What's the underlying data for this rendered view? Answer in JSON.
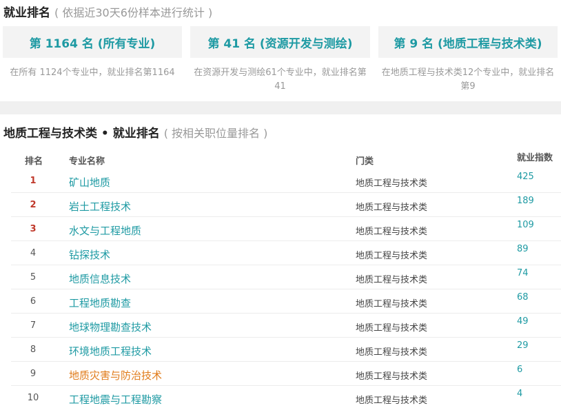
{
  "employment_ranking": {
    "title": "就业排名",
    "subtitle": "( 依据近30天6份样本进行统计 )",
    "cards": [
      {
        "label": "第 1164 名 (所有专业)",
        "desc": "在所有 1124个专业中，就业排名第1164"
      },
      {
        "label": "第 41 名 (资源开发与测绘)",
        "desc": "在资源开发与测绘61个专业中，就业排名第41"
      },
      {
        "label": "第 9 名 (地质工程与技术类)",
        "desc": "在地质工程与技术类12个专业中，就业排名第9"
      }
    ]
  },
  "category_ranking": {
    "title": "地质工程与技术类 • 就业排名",
    "subtitle": "( 按相关职位量排名 )",
    "headers": {
      "rank": "排名",
      "name": "专业名称",
      "category": "门类",
      "index": "就业指数"
    },
    "rows": [
      {
        "rank": "1",
        "name": "矿山地质",
        "category": "地质工程与技术类",
        "index": "425"
      },
      {
        "rank": "2",
        "name": "岩土工程技术",
        "category": "地质工程与技术类",
        "index": "189"
      },
      {
        "rank": "3",
        "name": "水文与工程地质",
        "category": "地质工程与技术类",
        "index": "109"
      },
      {
        "rank": "4",
        "name": "钻探技术",
        "category": "地质工程与技术类",
        "index": "89"
      },
      {
        "rank": "5",
        "name": "地质信息技术",
        "category": "地质工程与技术类",
        "index": "74"
      },
      {
        "rank": "6",
        "name": "工程地质勘查",
        "category": "地质工程与技术类",
        "index": "68"
      },
      {
        "rank": "7",
        "name": "地球物理勘查技术",
        "category": "地质工程与技术类",
        "index": "49"
      },
      {
        "rank": "8",
        "name": "环境地质工程技术",
        "category": "地质工程与技术类",
        "index": "29"
      },
      {
        "rank": "9",
        "name": "地质灾害与防治技术",
        "category": "地质工程与技术类",
        "index": "6"
      },
      {
        "rank": "10",
        "name": "工程地震与工程勘察",
        "category": "地质工程与技术类",
        "index": "4"
      }
    ]
  },
  "colors": {
    "accent": "#1e9aa3",
    "top_rank": "#c0392b",
    "highlight": "#e07b1a"
  }
}
